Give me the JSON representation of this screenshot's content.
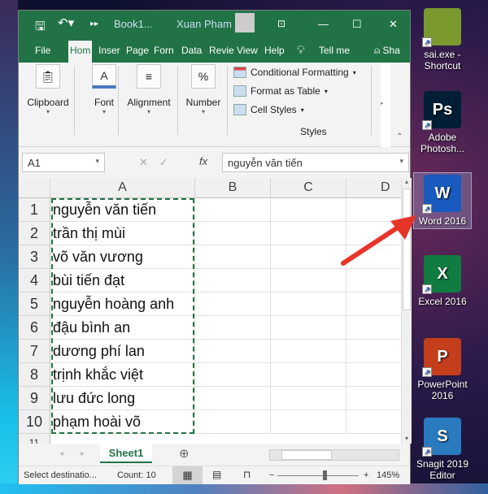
{
  "window": {
    "title": "Book1...",
    "user": "Xuan Pham"
  },
  "tabs": [
    "File",
    "Hom",
    "Inser",
    "Page",
    "Forn",
    "Data",
    "Revie",
    "View",
    "Help"
  ],
  "tell_me": "Tell me",
  "share": "Sha",
  "ribbon": {
    "groups": [
      "Clipboard",
      "Font",
      "Alignment",
      "Number"
    ],
    "styles": {
      "items": [
        "Conditional Formatting",
        "Format as Table",
        "Cell Styles"
      ],
      "label": "Styles"
    }
  },
  "formula": {
    "name_box": "A1",
    "fx": "fx",
    "value": "nguyễn văn tiến"
  },
  "columns": [
    "A",
    "B",
    "C",
    "D"
  ],
  "rows": [
    {
      "n": "1",
      "a": "nguyễn văn tiến"
    },
    {
      "n": "2",
      "a": "trần thị mùi"
    },
    {
      "n": "3",
      "a": "võ văn vương"
    },
    {
      "n": "4",
      "a": "bùi tiến đạt"
    },
    {
      "n": "5",
      "a": "nguyễn hoàng anh"
    },
    {
      "n": "6",
      "a": "đậu bình an"
    },
    {
      "n": "7",
      "a": "dương phí lan"
    },
    {
      "n": "8",
      "a": "trịnh khắc việt"
    },
    {
      "n": "9",
      "a": "lưu đức long"
    },
    {
      "n": "10",
      "a": "phạm hoài võ"
    }
  ],
  "sheet_tab": "Sheet1",
  "status": {
    "message": "Select destinatio...",
    "count": "Count: 10",
    "zoom": "145%",
    "zoom_percent": 145
  },
  "desktop": [
    {
      "label": "sai.exe - Shortcut",
      "color": "#7a9a30"
    },
    {
      "label": "Adobe Photosh...",
      "color": "#001e36",
      "glyph": "Ps"
    },
    {
      "label": "Word 2016",
      "color": "#185abd",
      "glyph": "W"
    },
    {
      "label": "Excel 2016",
      "color": "#107c41",
      "glyph": "X"
    },
    {
      "label": "PowerPoint 2016",
      "color": "#c43e1c",
      "glyph": "P"
    },
    {
      "label": "Snagit 2019 Editor",
      "color": "#2a7ac0",
      "glyph": "S"
    }
  ]
}
